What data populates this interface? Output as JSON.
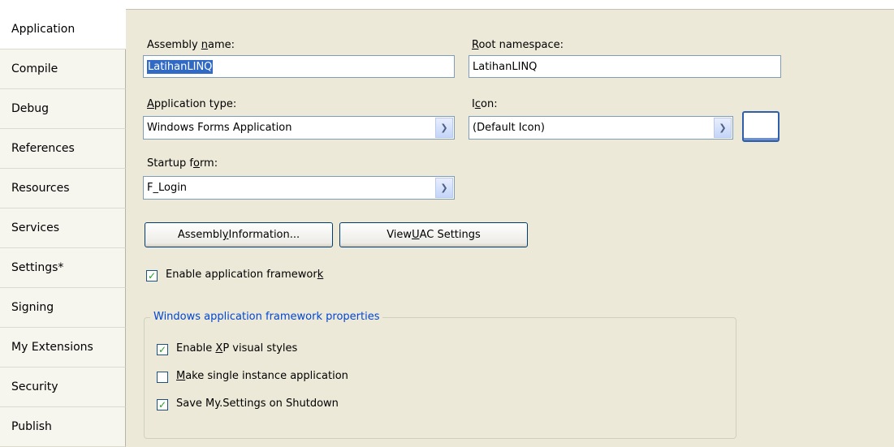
{
  "sidebar": {
    "items": [
      {
        "label": "Application",
        "active": true
      },
      {
        "label": "Compile"
      },
      {
        "label": "Debug"
      },
      {
        "label": "References"
      },
      {
        "label": "Resources"
      },
      {
        "label": "Services"
      },
      {
        "label": "Settings*"
      },
      {
        "label": "Signing"
      },
      {
        "label": "My Extensions"
      },
      {
        "label": "Security"
      },
      {
        "label": "Publish"
      }
    ]
  },
  "main": {
    "assembly_name": {
      "label_pre": "Assembly ",
      "label_key": "n",
      "label_post": "ame:",
      "value": "LatihanLINQ"
    },
    "root_namespace": {
      "label_key": "R",
      "label_post": "oot namespace:",
      "value": "LatihanLINQ"
    },
    "application_type": {
      "label_key": "A",
      "label_post": "pplication type:",
      "value": "Windows Forms Application"
    },
    "icon": {
      "label_pre": "I",
      "label_key": "c",
      "label_post": "on:",
      "value": "(Default Icon)"
    },
    "startup_form": {
      "label_pre": "Startup f",
      "label_key": "o",
      "label_post": "rm:",
      "value": "F_Login"
    },
    "assembly_info_button": {
      "pre": "Assembl",
      "key": "y",
      "post": " Information..."
    },
    "uac_button": {
      "pre": "View ",
      "key": "U",
      "post": "AC Settings"
    },
    "enable_framework": {
      "pre": "Enable application framewor",
      "key": "k",
      "post": "",
      "checked": true
    },
    "group_title": "Windows application framework properties",
    "xp_styles": {
      "pre": "Enable ",
      "key": "X",
      "post": "P visual styles",
      "checked": true
    },
    "single_instance": {
      "pre": "",
      "key": "M",
      "post": "ake single instance application",
      "checked": false
    },
    "save_settings": {
      "pre": "Save My.Settings on Shutdown",
      "key": "",
      "post": "",
      "checked": true
    }
  },
  "colors": {
    "accent": "#316ac5",
    "group_title": "#0046d5",
    "check": "#21a121"
  }
}
